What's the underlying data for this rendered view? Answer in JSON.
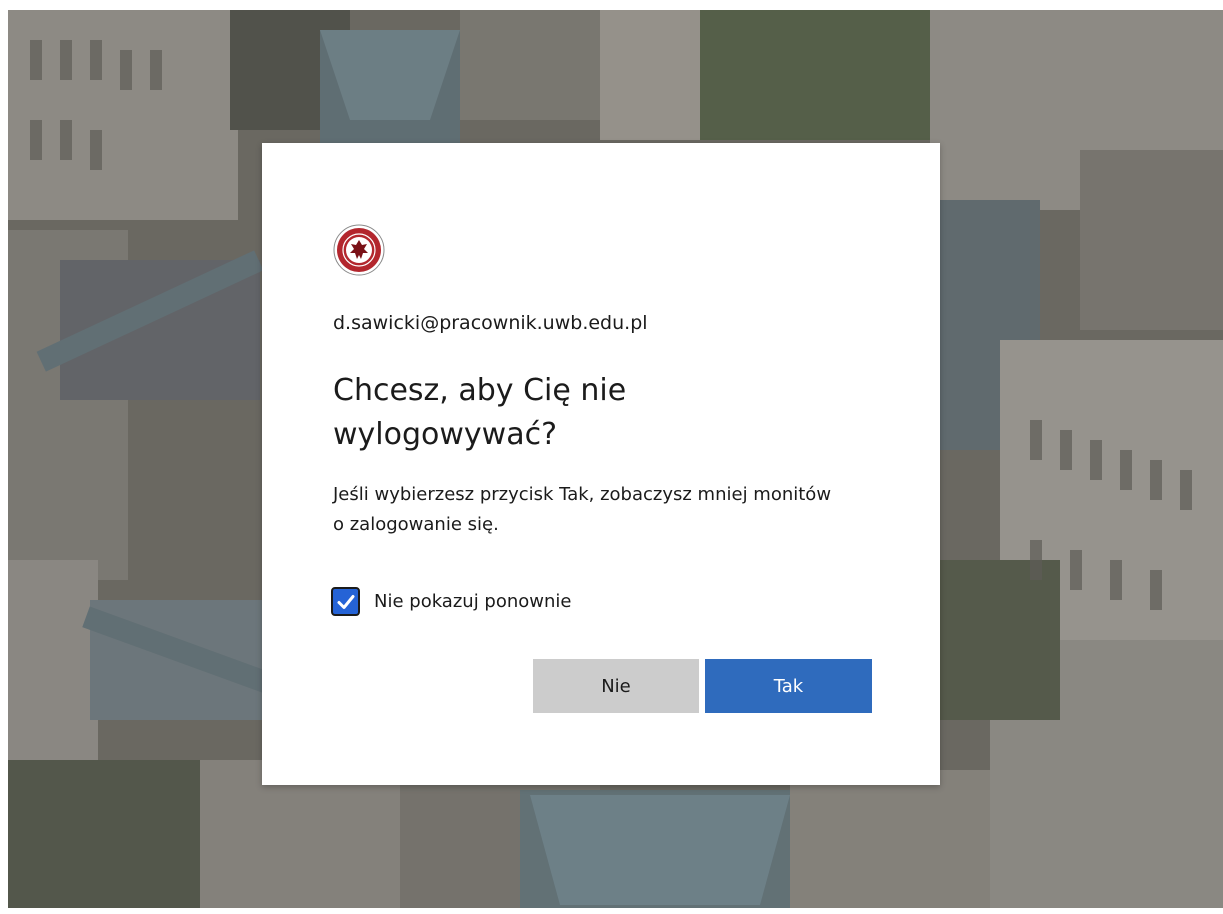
{
  "dialog": {
    "email": "d.sawicki@pracownik.uwb.edu.pl",
    "title": "Chcesz, aby Cię nie wylogowywać?",
    "description": "Jeśli wybierzesz przycisk Tak, zobaczysz mniej monitów o zalogowanie się.",
    "checkbox": {
      "label": "Nie pokazuj ponownie",
      "checked": true
    },
    "buttons": {
      "no_label": "Nie",
      "yes_label": "Tak"
    },
    "logo_icon": "university-seal-icon"
  },
  "colors": {
    "primary_button": "#2f6bbd",
    "secondary_button": "#cccccc",
    "checkbox_fill": "#2563d6",
    "text": "#1b1b1b",
    "logo_red": "#b3262d"
  }
}
